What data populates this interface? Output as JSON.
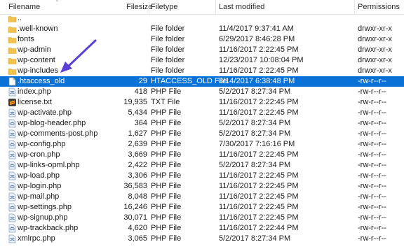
{
  "columns": {
    "filename": "Filename",
    "filesize": "Filesize",
    "filetype": "Filetype",
    "modified": "Last modified",
    "permissions": "Permissions"
  },
  "colors": {
    "selection": "#0a72d6",
    "folder": "#f2c24f",
    "arrow": "#5b3fd6"
  },
  "rows": [
    {
      "name": "..",
      "size": "",
      "type": "",
      "modified": "",
      "perms": "",
      "icon": "folder-icon"
    },
    {
      "name": ".well-known",
      "size": "",
      "type": "File folder",
      "modified": "11/4/2017 9:37:41 AM",
      "perms": "drwxr-xr-x",
      "icon": "folder-icon"
    },
    {
      "name": "fonts",
      "size": "",
      "type": "File folder",
      "modified": "6/29/2017 8:46:28 PM",
      "perms": "drwxr-xr-x",
      "icon": "folder-icon"
    },
    {
      "name": "wp-admin",
      "size": "",
      "type": "File folder",
      "modified": "11/16/2017 2:22:45 PM",
      "perms": "drwxr-xr-x",
      "icon": "folder-icon"
    },
    {
      "name": "wp-content",
      "size": "",
      "type": "File folder",
      "modified": "12/23/2017 10:08:04 PM",
      "perms": "drwxr-xr-x",
      "icon": "folder-icon"
    },
    {
      "name": "wp-includes",
      "size": "",
      "type": "File folder",
      "modified": "11/16/2017 2:22:45 PM",
      "perms": "drwxr-xr-x",
      "icon": "folder-icon"
    },
    {
      "name": ".htaccess_old",
      "size": "29",
      "type": "HTACCESS_OLD File",
      "modified": "8/14/2017 6:38:48 PM",
      "perms": "-rw-r--r--",
      "icon": "file-icon",
      "selected": true
    },
    {
      "name": "index.php",
      "size": "418",
      "type": "PHP File",
      "modified": "5/2/2017 8:27:34 PM",
      "perms": "-rw-r--r--",
      "icon": "php-file-icon"
    },
    {
      "name": "license.txt",
      "size": "19,935",
      "type": "TXT File",
      "modified": "11/16/2017 2:22:45 PM",
      "perms": "-rw-r--r--",
      "icon": "sublime-text-icon"
    },
    {
      "name": "wp-activate.php",
      "size": "5,434",
      "type": "PHP File",
      "modified": "11/16/2017 2:22:45 PM",
      "perms": "-rw-r--r--",
      "icon": "php-file-icon"
    },
    {
      "name": "wp-blog-header.php",
      "size": "364",
      "type": "PHP File",
      "modified": "5/2/2017 8:27:34 PM",
      "perms": "-rw-r--r--",
      "icon": "php-file-icon"
    },
    {
      "name": "wp-comments-post.php",
      "size": "1,627",
      "type": "PHP File",
      "modified": "5/2/2017 8:27:34 PM",
      "perms": "-rw-r--r--",
      "icon": "php-file-icon"
    },
    {
      "name": "wp-config.php",
      "size": "2,639",
      "type": "PHP File",
      "modified": "7/30/2017 7:16:16 PM",
      "perms": "-rw-r--r--",
      "icon": "php-file-icon"
    },
    {
      "name": "wp-cron.php",
      "size": "3,669",
      "type": "PHP File",
      "modified": "11/16/2017 2:22:45 PM",
      "perms": "-rw-r--r--",
      "icon": "php-file-icon"
    },
    {
      "name": "wp-links-opml.php",
      "size": "2,422",
      "type": "PHP File",
      "modified": "5/2/2017 8:27:34 PM",
      "perms": "-rw-r--r--",
      "icon": "php-file-icon"
    },
    {
      "name": "wp-load.php",
      "size": "3,306",
      "type": "PHP File",
      "modified": "11/16/2017 2:22:45 PM",
      "perms": "-rw-r--r--",
      "icon": "php-file-icon"
    },
    {
      "name": "wp-login.php",
      "size": "36,583",
      "type": "PHP File",
      "modified": "11/16/2017 2:22:45 PM",
      "perms": "-rw-r--r--",
      "icon": "php-file-icon"
    },
    {
      "name": "wp-mail.php",
      "size": "8,048",
      "type": "PHP File",
      "modified": "11/16/2017 2:22:45 PM",
      "perms": "-rw-r--r--",
      "icon": "php-file-icon"
    },
    {
      "name": "wp-settings.php",
      "size": "16,246",
      "type": "PHP File",
      "modified": "11/16/2017 2:22:45 PM",
      "perms": "-rw-r--r--",
      "icon": "php-file-icon"
    },
    {
      "name": "wp-signup.php",
      "size": "30,071",
      "type": "PHP File",
      "modified": "11/16/2017 2:22:45 PM",
      "perms": "-rw-r--r--",
      "icon": "php-file-icon"
    },
    {
      "name": "wp-trackback.php",
      "size": "4,620",
      "type": "PHP File",
      "modified": "11/16/2017 2:22:44 PM",
      "perms": "-rw-r--r--",
      "icon": "php-file-icon"
    },
    {
      "name": "xmlrpc.php",
      "size": "3,065",
      "type": "PHP File",
      "modified": "5/2/2017 8:27:34 PM",
      "perms": "-rw-r--r--",
      "icon": "php-file-icon"
    }
  ]
}
